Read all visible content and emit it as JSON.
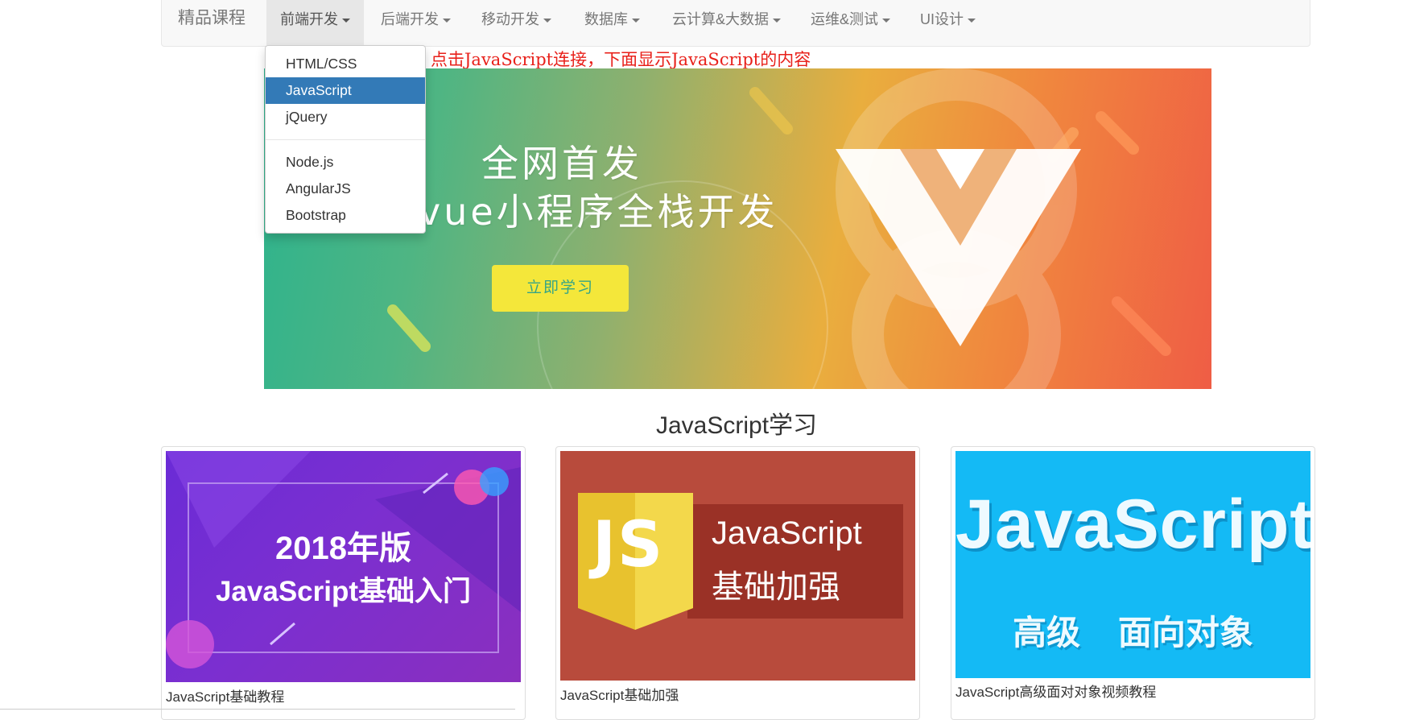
{
  "navbar": {
    "brand": "精品课程",
    "items": [
      {
        "label": "前端开发"
      },
      {
        "label": "后端开发"
      },
      {
        "label": "移动开发"
      },
      {
        "label": "数据库"
      },
      {
        "label": "云计算&大数据"
      },
      {
        "label": "运维&测试"
      },
      {
        "label": "UI设计"
      }
    ]
  },
  "dropdown": {
    "items": [
      {
        "label": "HTML/CSS"
      },
      {
        "label": "JavaScript"
      },
      {
        "label": "jQuery"
      },
      {
        "label": "Node.js"
      },
      {
        "label": "AngularJS"
      },
      {
        "label": "Bootstrap"
      }
    ],
    "selected": "JavaScript"
  },
  "note": "点击JavaScript连接，下面显示JavaScript的内容",
  "banner": {
    "title_line1": "全网首发",
    "title_line2": "vue小程序全栈开发",
    "button": "立即学习"
  },
  "section_title": "JavaScript学习",
  "cards": [
    {
      "image_line1": "2018年版",
      "image_line2": "JavaScript基础入门",
      "caption": "JavaScript基础教程"
    },
    {
      "image_badge": "JS",
      "image_line1": "JavaScript",
      "image_line2": "基础加强",
      "caption": "JavaScript基础加强"
    },
    {
      "image_line1": "JavaScript",
      "image_line2": "高级    面向对象",
      "caption": "JavaScript高级面对对象视频教程"
    }
  ],
  "colors": {
    "accent_selected": "#337ab7",
    "note_red": "#e8201a",
    "navbar_bg": "#f8f8f8"
  }
}
